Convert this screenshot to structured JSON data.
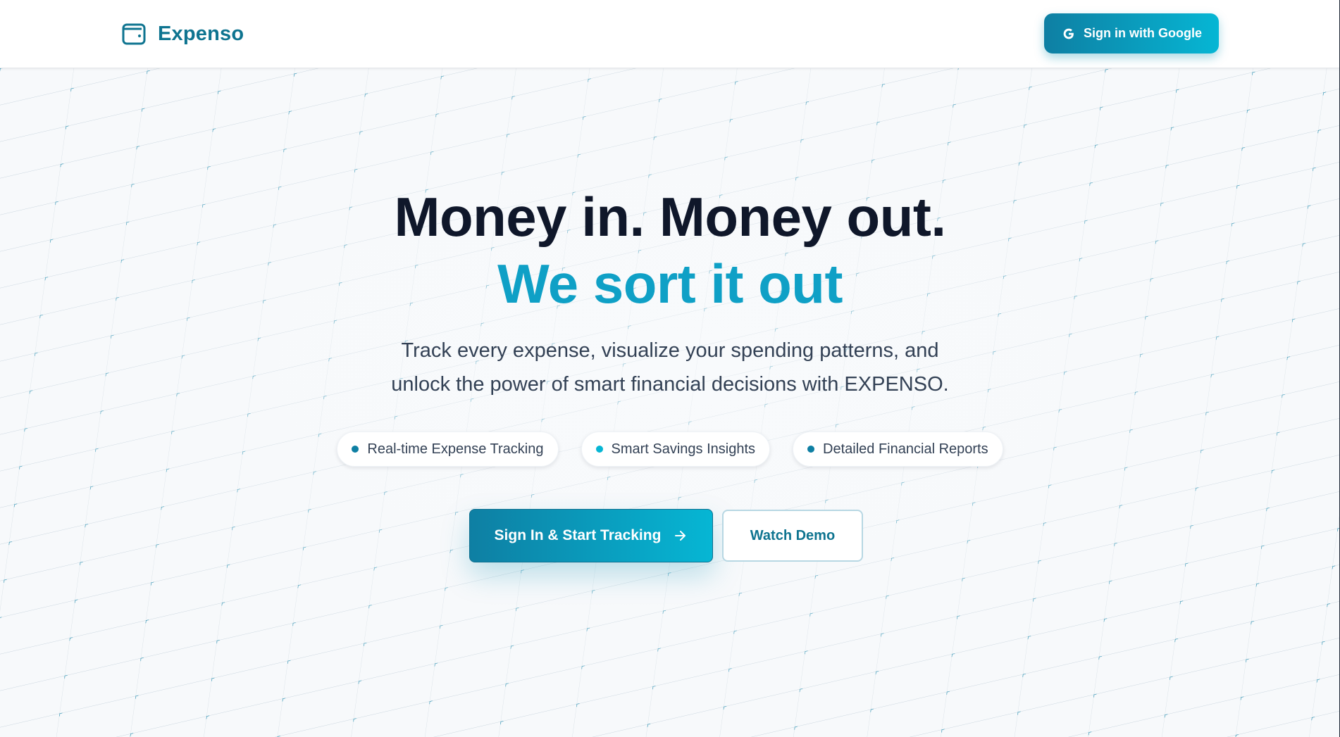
{
  "header": {
    "brand_name": "Expenso",
    "brand_icon": "wallet-icon",
    "google_button_label": "Sign in with Google",
    "google_icon": "google-g-icon"
  },
  "hero": {
    "title_line1": "Money in. Money out.",
    "title_line2": "We sort it out",
    "subtitle_line1": "Track every expense, visualize your spending patterns, and",
    "subtitle_line2": "unlock the power of smart financial decisions with EXPENSO.",
    "features": [
      {
        "label": "Real-time Expense Tracking",
        "dot_color": "#0e7fa3"
      },
      {
        "label": "Smart Savings Insights",
        "dot_color": "#06b6d4"
      },
      {
        "label": "Detailed Financial Reports",
        "dot_color": "#0e7fa3"
      }
    ],
    "primary_cta_label": "Sign In & Start Tracking",
    "primary_cta_icon": "arrow-right-icon",
    "secondary_cta_label": "Watch Demo"
  },
  "colors": {
    "brand": "#0e7490",
    "accent": "#06b6d4",
    "accent_dark": "#0e7fa3",
    "heading": "#0f172a",
    "heading_accent": "#0fa0c6"
  }
}
